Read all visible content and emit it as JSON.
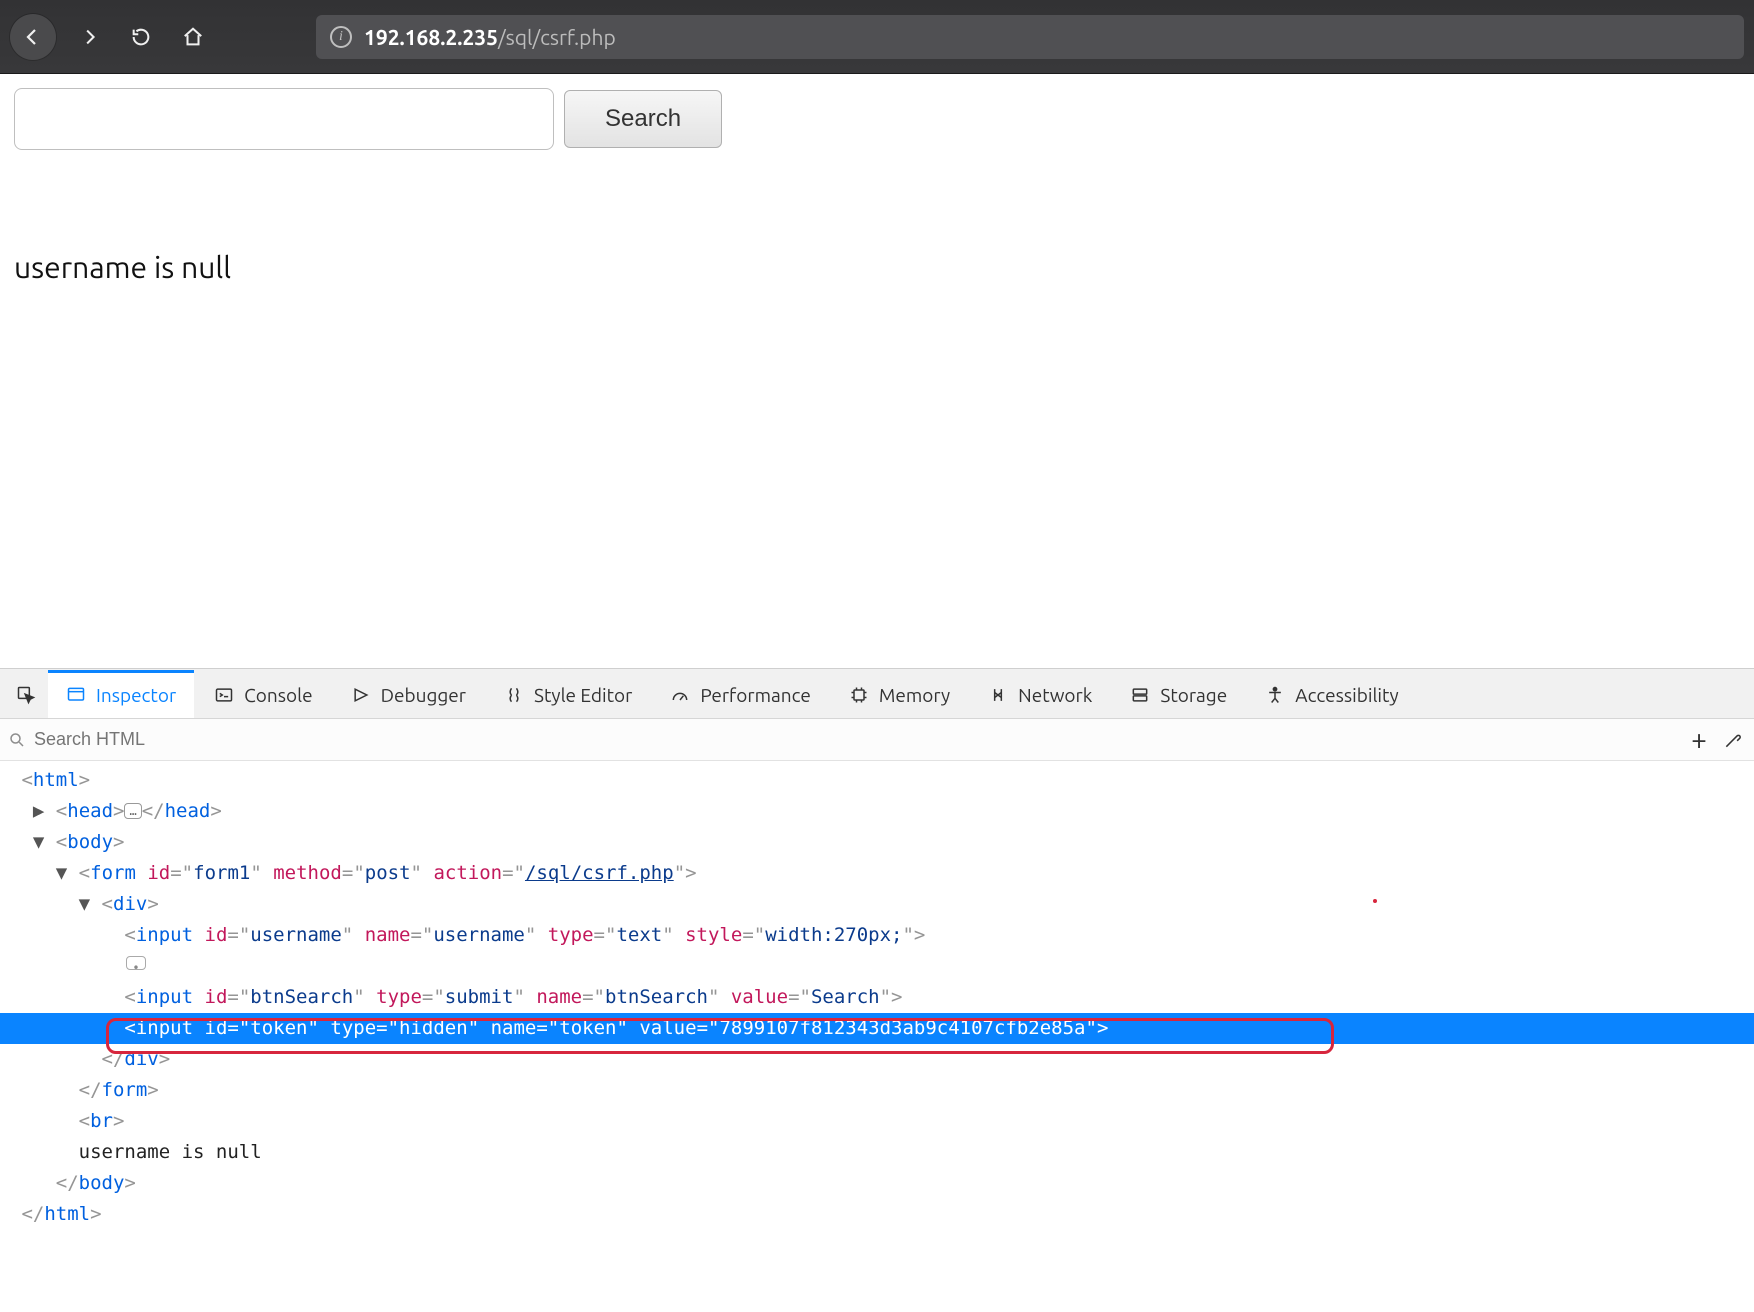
{
  "browser": {
    "url_host": "192.168.2.235",
    "url_path": "/sql/csrf.php"
  },
  "page": {
    "search_button_label": "Search",
    "input_value": "",
    "result_text": "username is null"
  },
  "devtools": {
    "tabs": {
      "inspector": "Inspector",
      "console": "Console",
      "debugger": "Debugger",
      "style_editor": "Style Editor",
      "performance": "Performance",
      "memory": "Memory",
      "network": "Network",
      "storage": "Storage",
      "accessibility": "Accessibility"
    },
    "search_placeholder": "Search HTML",
    "dom": {
      "form_id": "form1",
      "form_method": "post",
      "form_action": "/sql/csrf.php",
      "input_username": {
        "id": "username",
        "name": "username",
        "type": "text",
        "style": "width:270px;"
      },
      "input_btn": {
        "id": "btnSearch",
        "type": "submit",
        "name": "btnSearch",
        "value": "Search"
      },
      "input_token": {
        "id": "token",
        "type": "hidden",
        "name": "token",
        "value": "7899107f812343d3ab9c4107cfb2e85a"
      },
      "body_text": "username is null"
    }
  }
}
